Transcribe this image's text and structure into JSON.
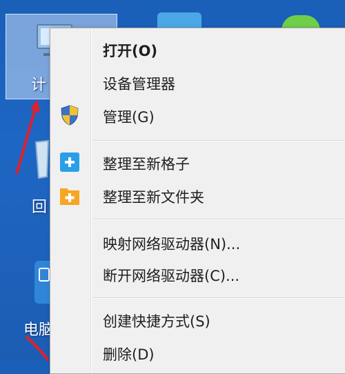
{
  "desktop": {
    "computer_label": "计",
    "recycle_label": "回",
    "pc_label": "电脑"
  },
  "menu": {
    "items": [
      {
        "label": "打开(O)",
        "icon": ""
      },
      {
        "label": "设备管理器",
        "icon": ""
      },
      {
        "label": "管理(G)",
        "icon": "uac-shield-icon"
      },
      {
        "label": "整理至新格子",
        "icon": "add-grid-icon"
      },
      {
        "label": "整理至新文件夹",
        "icon": "add-folder-icon"
      },
      {
        "label": "映射网络驱动器(N)...",
        "icon": ""
      },
      {
        "label": "断开网络驱动器(C)...",
        "icon": ""
      },
      {
        "label": "创建快捷方式(S)",
        "icon": ""
      },
      {
        "label": "删除(D)",
        "icon": ""
      }
    ]
  },
  "colors": {
    "desktop_blue": "#1e66c4",
    "menu_bg": "#f0f0f0",
    "add_grid_blue": "#2a9fe8",
    "add_folder_orange": "#f5a623",
    "arrow_red": "#e0202a"
  }
}
